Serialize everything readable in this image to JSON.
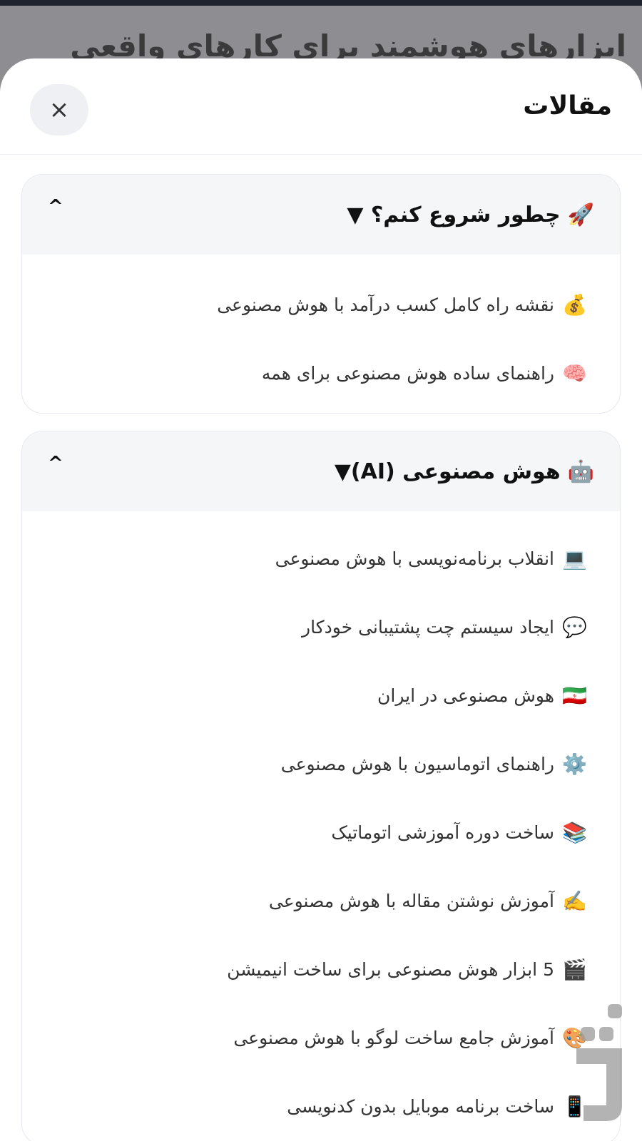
{
  "background": {
    "title": "ابزارهای هوشمند برای کارهای واقعی"
  },
  "sheet": {
    "title": "مقالات",
    "close_icon": "×"
  },
  "sections": [
    {
      "emoji": "🚀",
      "title": "چطور شروع کنم؟ ▼",
      "caret": "^",
      "items": [
        {
          "icon": "💰",
          "label": "نقشه راه کامل کسب درآمد با هوش مصنوعی"
        },
        {
          "icon": "🧠",
          "label": "راهنمای ساده هوش مصنوعی برای همه"
        }
      ]
    },
    {
      "emoji": "🤖",
      "title": "هوش مصنوعی (AI)▼",
      "caret": "^",
      "items": [
        {
          "icon": "💻",
          "label": "انقلاب برنامه‌نویسی با هوش مصنوعی"
        },
        {
          "icon": "💬",
          "label": "ایجاد سیستم چت پشتیبانی خودکار"
        },
        {
          "icon": "🇮🇷",
          "label": "هوش مصنوعی در ایران"
        },
        {
          "icon": "⚙️",
          "label": "راهنمای اتوماسیون با هوش مصنوعی"
        },
        {
          "icon": "📚",
          "label": "ساخت دوره آموزشی اتوماتیک"
        },
        {
          "icon": "✍️",
          "label": "آموزش نوشتن مقاله با هوش مصنوعی"
        },
        {
          "icon": "🎬",
          "label": "5 ابزار هوش مصنوعی برای ساخت انیمیشن"
        },
        {
          "icon": "🎨",
          "label": "آموزش جامع ساخت لوگو با هوش مصنوعی"
        },
        {
          "icon": "📱",
          "label": "ساخت برنامه موبایل بدون کدنویسی"
        }
      ]
    }
  ]
}
